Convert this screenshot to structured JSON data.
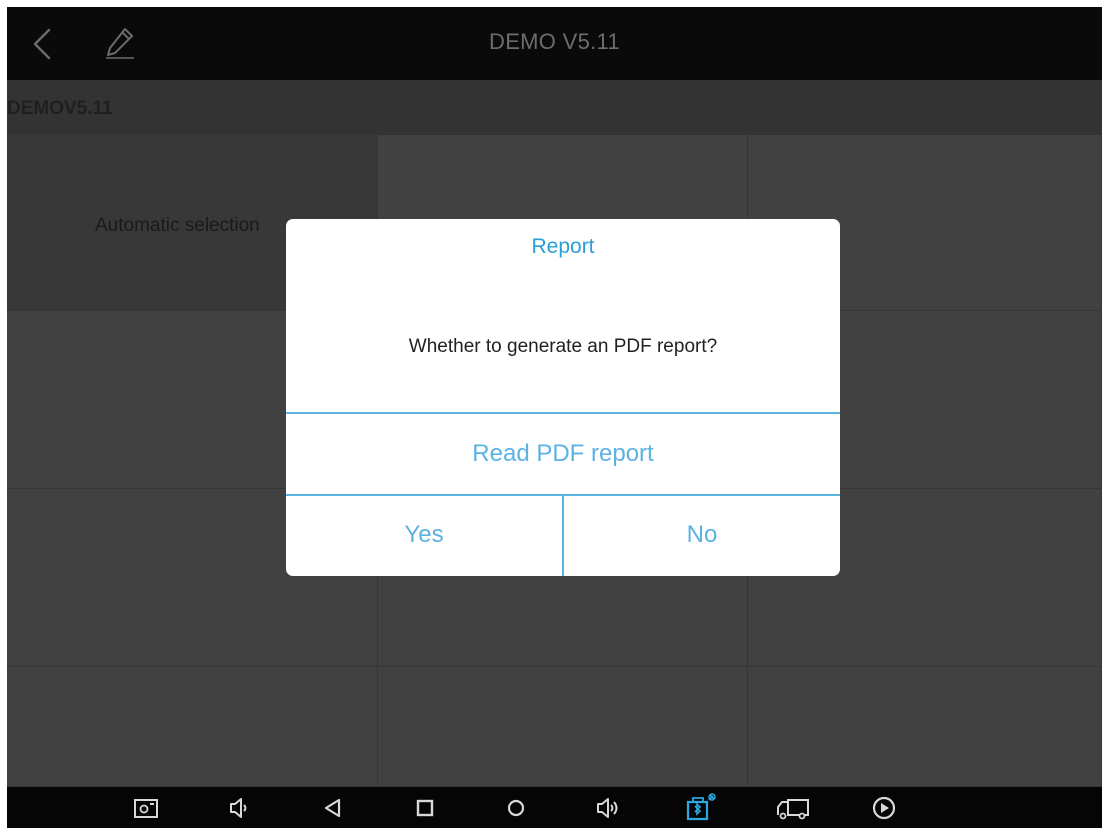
{
  "header": {
    "title": "DEMO V5.11",
    "back_icon": "back-chevron-icon",
    "edit_icon": "pencil-icon"
  },
  "breadcrumb": {
    "text": "DEMOV5.11"
  },
  "grid": {
    "cells": [
      {
        "label": "Automatic selection",
        "selected": true
      },
      {
        "label": ""
      },
      {
        "label": ""
      },
      {
        "label": ""
      },
      {
        "label": ""
      },
      {
        "label": ""
      },
      {
        "label": ""
      },
      {
        "label": ""
      },
      {
        "label": ""
      },
      {
        "label": ""
      },
      {
        "label": ""
      },
      {
        "label": ""
      }
    ]
  },
  "dialog": {
    "title": "Report",
    "message": "Whether to generate an PDF report?",
    "read_button": "Read PDF report",
    "yes_button": "Yes",
    "no_button": "No"
  },
  "navbar": {
    "icons": [
      "screenshot-icon",
      "volume-down-icon",
      "back-triangle-icon",
      "recent-apps-square-icon",
      "home-circle-icon",
      "volume-up-icon",
      "vci-connection-icon",
      "truck-icon",
      "play-circle-icon"
    ]
  },
  "colors": {
    "accent": "#2a9fd6",
    "button_text": "#5cb2e3",
    "background": "#3e3e3e",
    "titlebar": "#0a0a0a"
  }
}
